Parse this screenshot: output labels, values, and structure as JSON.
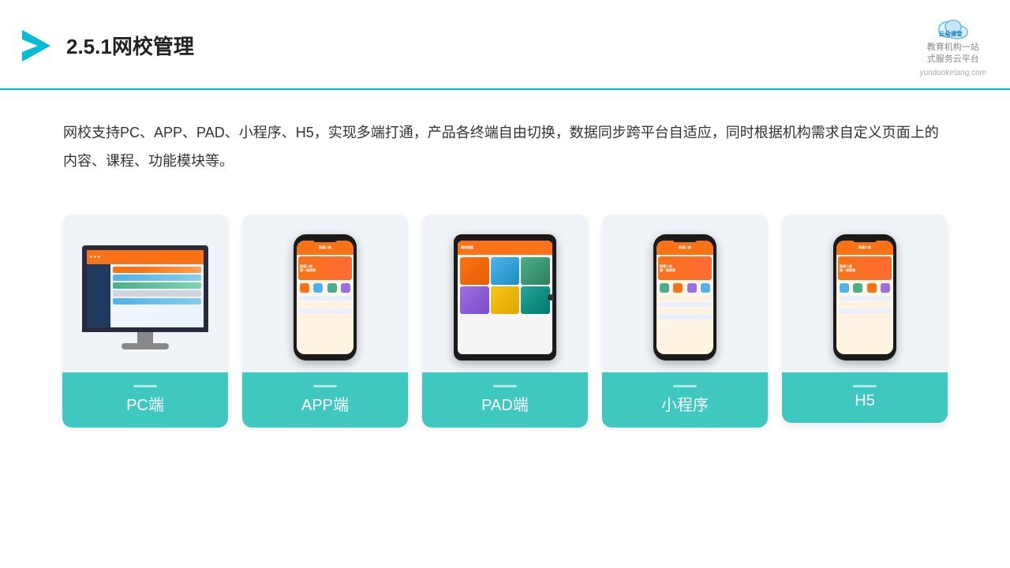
{
  "header": {
    "title": "2.5.1网校管理",
    "brand": {
      "name": "云朵课堂",
      "url": "yunduoketang.com",
      "slogan": "教育机构一站\n式服务云平台"
    }
  },
  "description": {
    "text": "网校支持PC、APP、PAD、小程序、H5，实现多端打通，产品各终端自由切换，数据同步跨平台自适应，同时根据机构需求自定义页面上的内容、课程、功能模块等。"
  },
  "cards": [
    {
      "id": "pc",
      "label": "PC端"
    },
    {
      "id": "app",
      "label": "APP端"
    },
    {
      "id": "pad",
      "label": "PAD端"
    },
    {
      "id": "miniprogram",
      "label": "小程序"
    },
    {
      "id": "h5",
      "label": "H5"
    }
  ]
}
